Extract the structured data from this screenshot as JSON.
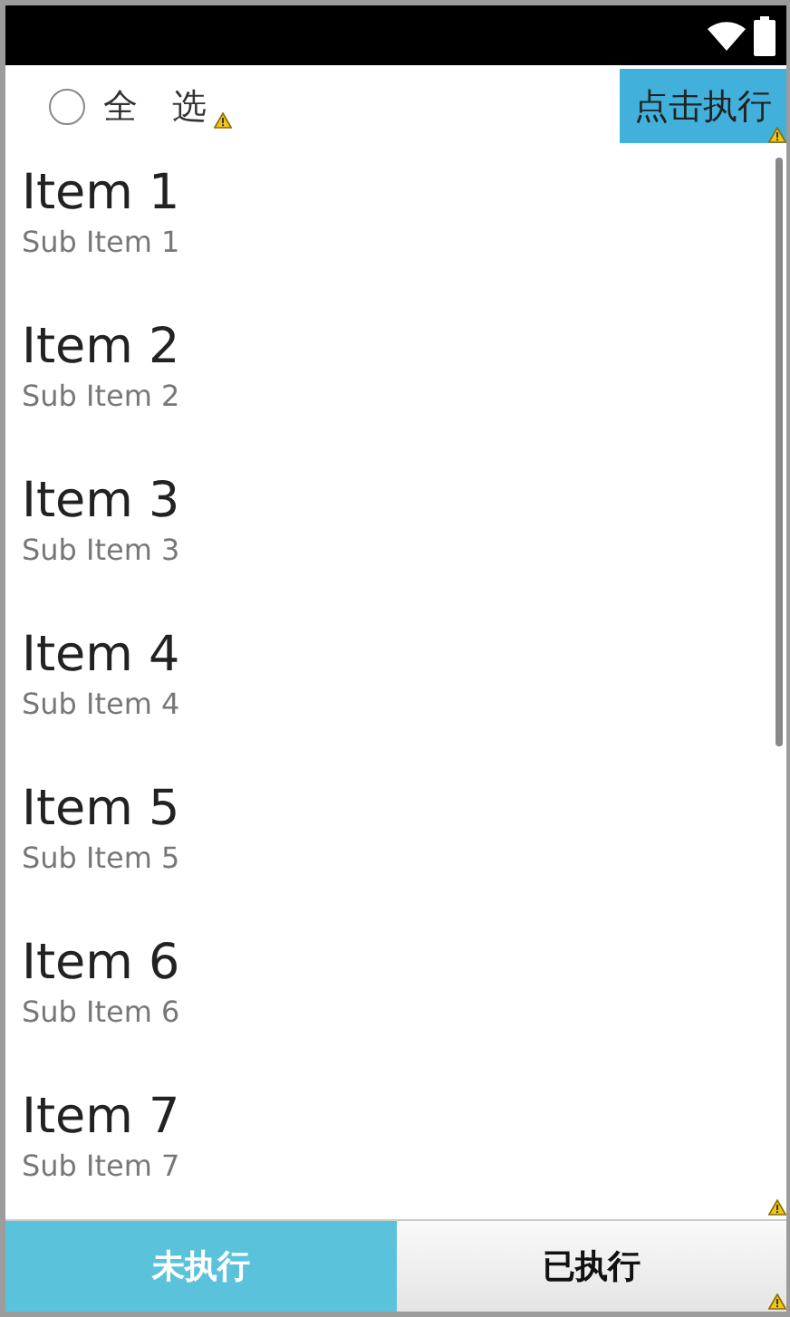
{
  "header": {
    "select_all": {
      "label": "全　选",
      "checked": false
    },
    "execute_button": {
      "label": "点击执行"
    }
  },
  "items": [
    {
      "title": "Item 1",
      "subtitle": "Sub Item 1"
    },
    {
      "title": "Item 2",
      "subtitle": "Sub Item 2"
    },
    {
      "title": "Item 3",
      "subtitle": "Sub Item 3"
    },
    {
      "title": "Item 4",
      "subtitle": "Sub Item 4"
    },
    {
      "title": "Item 5",
      "subtitle": "Sub Item 5"
    },
    {
      "title": "Item 6",
      "subtitle": "Sub Item 6"
    },
    {
      "title": "Item 7",
      "subtitle": "Sub Item 7"
    }
  ],
  "tabs": [
    {
      "label": "未执行",
      "selected": true
    },
    {
      "label": "已执行",
      "selected": false
    }
  ]
}
